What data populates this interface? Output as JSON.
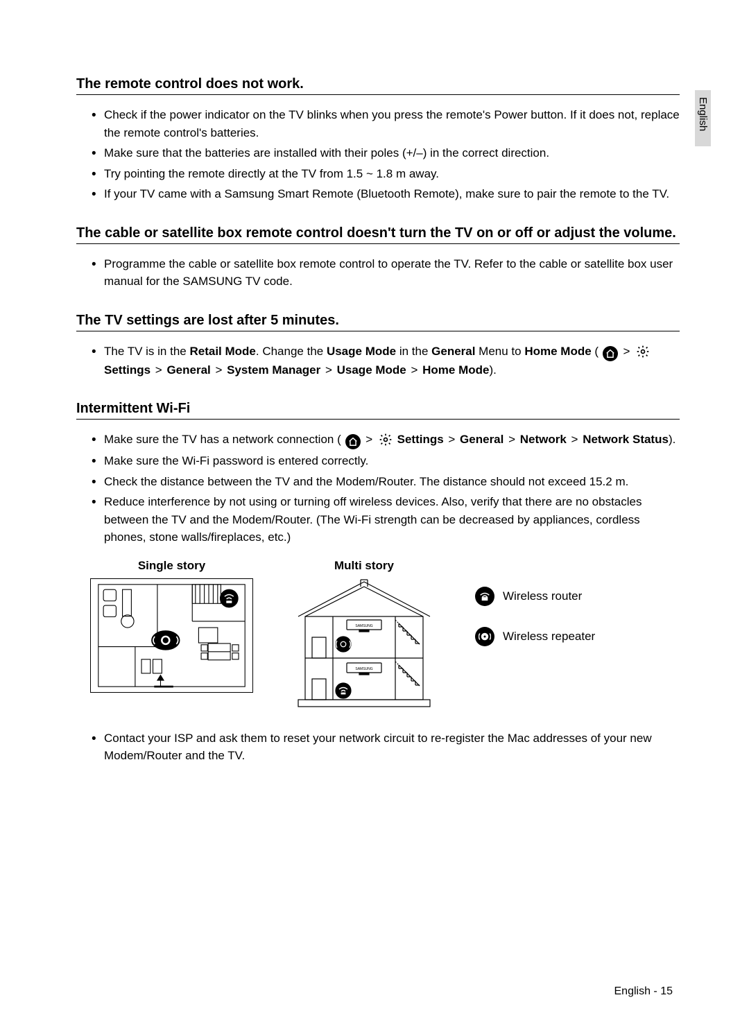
{
  "side_tab": "English",
  "sections": {
    "remote": {
      "title": "The remote control does not work.",
      "items": [
        "Check if the power indicator on the TV blinks when you press the remote's Power button. If it does not, replace the remote control's batteries.",
        "Make sure that the batteries are installed with their poles (+/–) in the correct direction.",
        "Try pointing the remote directly at the TV from 1.5 ~ 1.8 m away.",
        "If your TV came with a Samsung Smart Remote (Bluetooth Remote), make sure to pair the remote to the TV."
      ]
    },
    "cable": {
      "title": "The cable or satellite box remote control doesn't turn the TV on or off or adjust the volume.",
      "item": "Programme the cable or satellite box remote control to operate the TV. Refer to the cable or satellite box user manual for the SAMSUNG TV code."
    },
    "settings_lost": {
      "title": "The TV settings are lost after 5 minutes.",
      "pre": "The TV is in the ",
      "retail_mode": "Retail Mode",
      "mid1": ". Change the ",
      "usage_mode": "Usage Mode",
      "mid2": " in the ",
      "general": "General",
      "mid3": " Menu to ",
      "home_mode": "Home Mode",
      "open": " (",
      "sep": " > ",
      "path": {
        "settings": "Settings",
        "general": "General",
        "system_manager": "System Manager",
        "usage_mode": "Usage Mode",
        "home_mode": "Home Mode"
      },
      "close": ")."
    },
    "wifi": {
      "title": "Intermittent Wi-Fi",
      "item1_pre": "Make sure the TV has a network connection (",
      "item1_close": ").",
      "path": {
        "settings": "Settings",
        "general": "General",
        "network": "Network",
        "network_status": "Network Status"
      },
      "item2": "Make sure the Wi-Fi password is entered correctly.",
      "item3": "Check the distance between the TV and the Modem/Router. The distance should not exceed 15.2 m.",
      "item4": "Reduce interference by not using or turning off wireless devices. Also, verify that there are no obstacles between the TV and the Modem/Router. (The Wi-Fi strength can be decreased by appliances, cordless phones, stone walls/fireplaces, etc.)",
      "item5": "Contact your ISP and ask them to reset your network circuit to re-register the Mac addresses of your new Modem/Router and the TV."
    },
    "diagrams": {
      "single": "Single story",
      "multi": "Multi story",
      "legend_router": "Wireless router",
      "legend_repeater": "Wireless repeater",
      "samsung": "SAMSUNG"
    }
  },
  "footer": "English - 15"
}
